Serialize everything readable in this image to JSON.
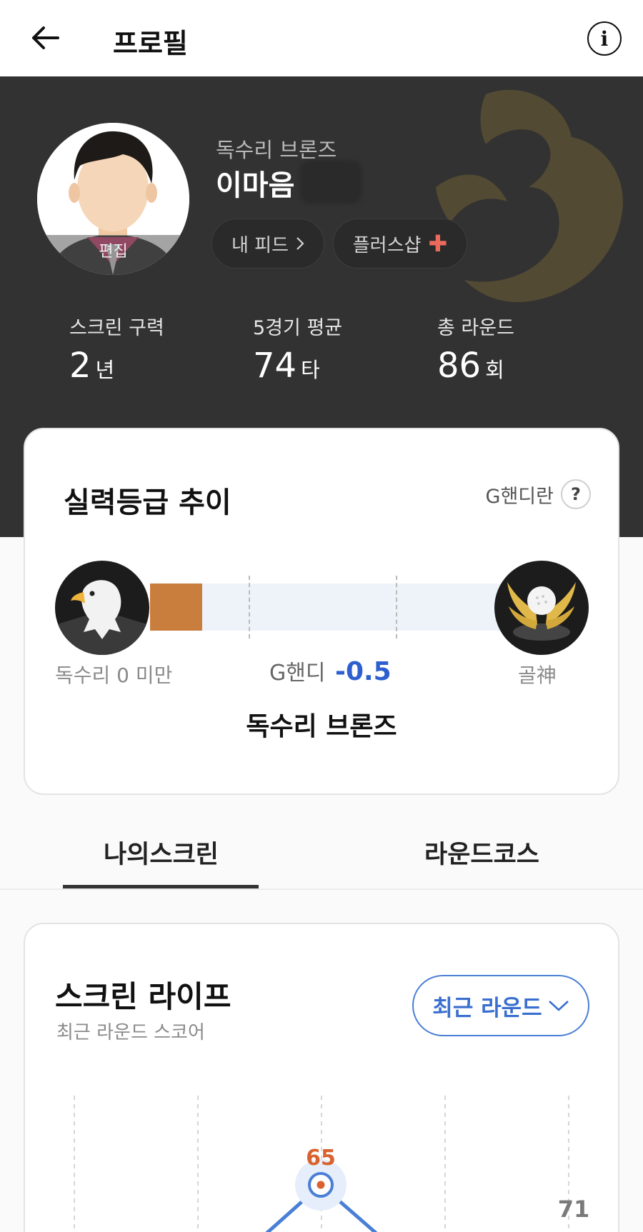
{
  "header": {
    "title": "프로필"
  },
  "profile": {
    "avatar_edit_label": "편집",
    "rank_label": "독수리 브론즈",
    "name": "이마음",
    "feed_button": "내 피드",
    "plusshop_button": "플러스샵"
  },
  "stats": [
    {
      "label": "스크린 구력",
      "value": "2",
      "unit": "년"
    },
    {
      "label": "5경기 평균",
      "value": "74",
      "unit": "타"
    },
    {
      "label": "총 라운드",
      "value": "86",
      "unit": "회"
    }
  ],
  "grade_card": {
    "title": "실력등급 추이",
    "help_link": "G핸디란",
    "help_icon_label": "?",
    "min_grade": "독수리 0 미만",
    "max_grade": "골神",
    "ghandi_label": "G핸디",
    "ghandi_value": "-0.5",
    "current_grade": "독수리 브론즈",
    "progress_fraction": 0.14
  },
  "tabs": [
    {
      "label": "나의스크린",
      "active": true
    },
    {
      "label": "라운드코스",
      "active": false
    }
  ],
  "screen_life": {
    "title": "스크린 라이프",
    "subtitle": "최근 라운드 스코어",
    "filter_label": "최근 라운드",
    "score_labels": [
      "65",
      "71"
    ]
  },
  "colors": {
    "hero_bg": "#323232",
    "accent_blue": "#2e5fd0",
    "bronze": "#c97e3d",
    "score_orange": "#d9622e"
  }
}
